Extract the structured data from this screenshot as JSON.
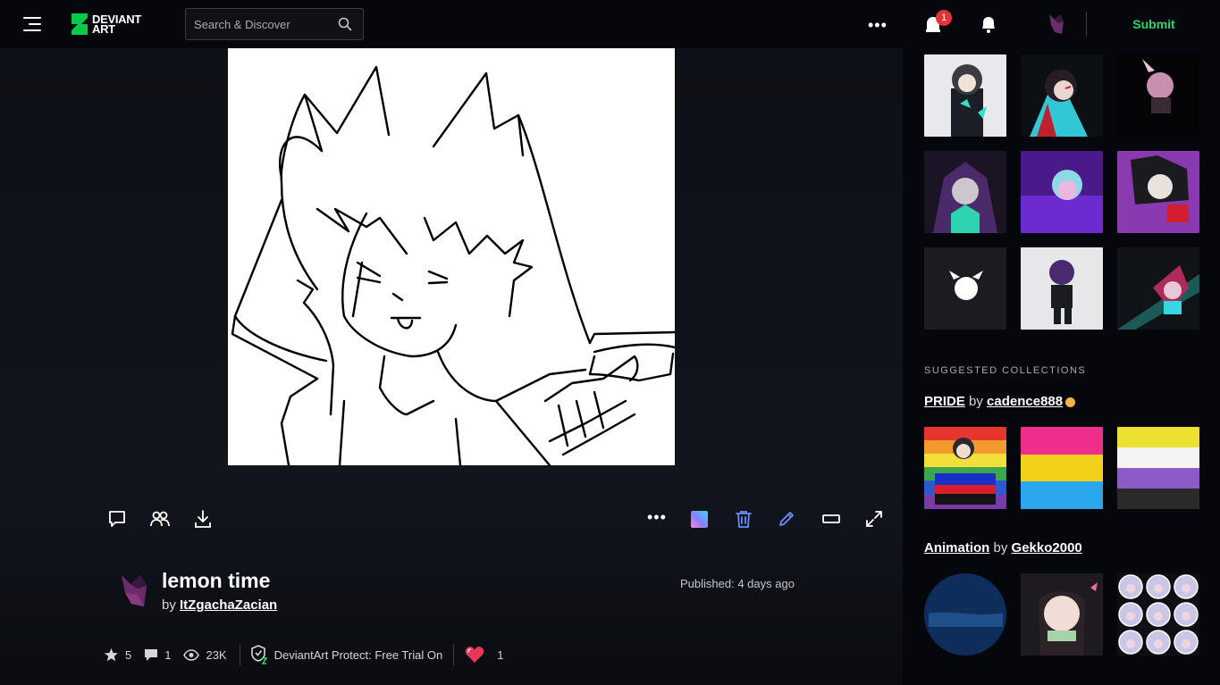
{
  "header": {
    "logo_text_line1": "DEVIANT",
    "logo_text_line2": "ART",
    "search_placeholder": "Search & Discover",
    "notification_count": "1",
    "submit_label": "Submit"
  },
  "artwork": {
    "title": "lemon time",
    "by_label": "by",
    "author": "ItZgachaZacian",
    "published": "Published: 4 days ago"
  },
  "stats": {
    "favourites": "5",
    "comments": "1",
    "views": "23K",
    "protect_label": "DeviantArt Protect: Free Trial On",
    "reactions": "1"
  },
  "sidebar": {
    "suggested_label": "SUGGESTED COLLECTIONS",
    "collections": [
      {
        "name": "PRIDE",
        "by": "by",
        "owner": "cadence888"
      },
      {
        "name": "Animation",
        "by": "by",
        "owner": "Gekko2000"
      }
    ]
  },
  "colors": {
    "accent": "#2ed46f",
    "badge": "#e2323a",
    "background": "#06070d"
  }
}
